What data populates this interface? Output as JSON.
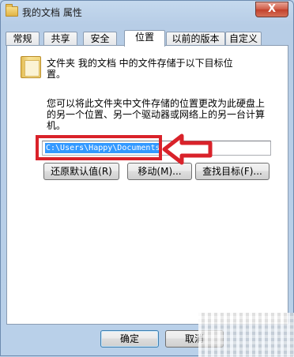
{
  "window": {
    "title": "我的文档 属性",
    "close_symbol": "X"
  },
  "tabs": [
    {
      "label": "常规",
      "active": false
    },
    {
      "label": "共享",
      "active": false
    },
    {
      "label": "安全",
      "active": false
    },
    {
      "label": "位置",
      "active": true
    },
    {
      "label": "以前的版本",
      "active": false
    },
    {
      "label": "自定义",
      "active": false
    }
  ],
  "location": {
    "folder_icon": "folder-icon",
    "intro_line1": "文件夹 我的文档 中的文件存储于以下目标位",
    "intro_line2": "置。",
    "desc_line1": "您可以将此文件夹中文件存储的位置更改为此硬盘上",
    "desc_line2": "的另一个位置、另一个驱动器或网络上的另一台计算",
    "desc_line3": "机。",
    "path_value": "C:\\Users\\Happy\\Documents",
    "restore_button": "还原默认值(R)",
    "move_button": "移动(M)...",
    "find_target_button": "查找目标(F)..."
  },
  "footer": {
    "ok_button": "确定",
    "cancel_button": "取消"
  },
  "annotation": {
    "highlight_color": "#d9222a",
    "arrow_color": "#d9222a"
  }
}
